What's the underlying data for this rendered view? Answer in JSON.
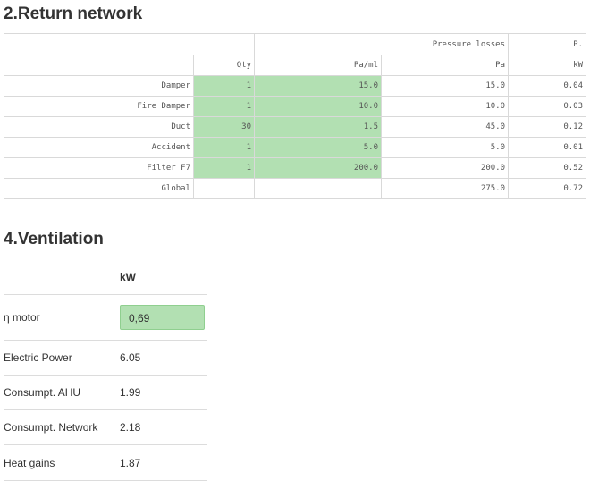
{
  "return_network": {
    "title": "2.Return network",
    "header": {
      "group_pressure": "Pressure losses",
      "group_power": "P.",
      "col_qty": "Qty",
      "col_pa_ml": "Pa/ml",
      "col_pa": "Pa",
      "col_kw": "kW"
    },
    "rows": [
      {
        "name": "Damper",
        "qty": "1",
        "pa_ml": "15.0",
        "pa": "15.0",
        "kw": "0.04"
      },
      {
        "name": "Fire Damper",
        "qty": "1",
        "pa_ml": "10.0",
        "pa": "10.0",
        "kw": "0.03"
      },
      {
        "name": "Duct",
        "qty": "30",
        "pa_ml": "1.5",
        "pa": "45.0",
        "kw": "0.12"
      },
      {
        "name": "Accident",
        "qty": "1",
        "pa_ml": "5.0",
        "pa": "5.0",
        "kw": "0.01"
      },
      {
        "name": "Filter F7",
        "qty": "1",
        "pa_ml": "200.0",
        "pa": "200.0",
        "kw": "0.52"
      }
    ],
    "global": {
      "name": "Global",
      "pa": "275.0",
      "kw": "0.72"
    }
  },
  "ventilation": {
    "title": "4.Ventilation",
    "unit_header": "kW",
    "eta_label": "η motor",
    "eta_value": "0,69",
    "rows": [
      {
        "label": "Electric Power",
        "value": "6.05"
      },
      {
        "label": "Consumpt. AHU",
        "value": "1.99"
      },
      {
        "label": "Consumpt. Network",
        "value": "2.18"
      },
      {
        "label": "Heat gains",
        "value": "1.87"
      }
    ]
  },
  "colors": {
    "input_green": "#b2e0b2",
    "border": "#d9d9d9"
  }
}
